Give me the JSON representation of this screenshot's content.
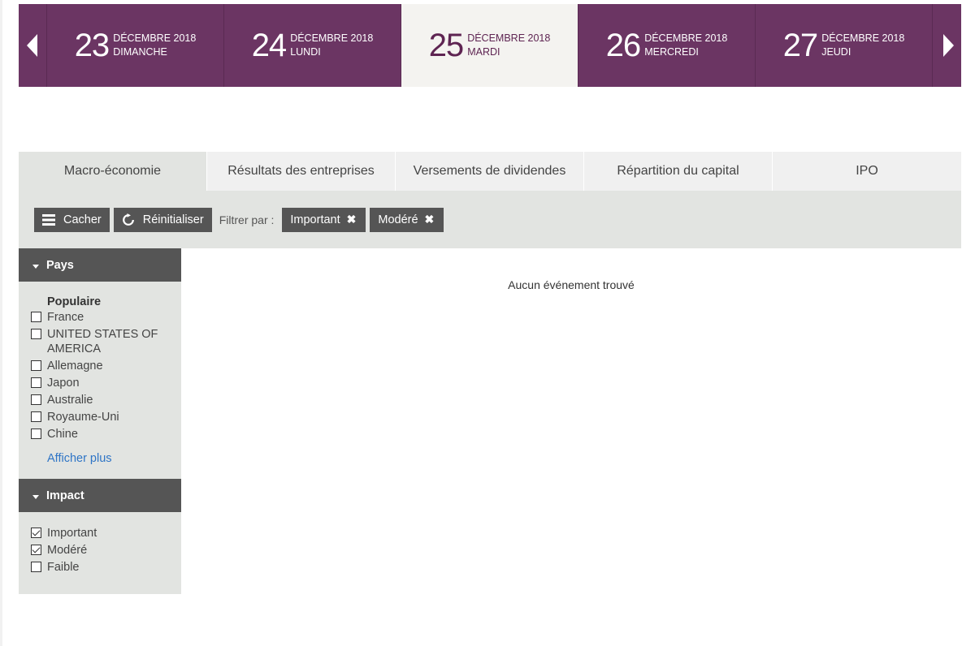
{
  "dates": {
    "prev_icon": "chevron-left-icon",
    "next_icon": "chevron-right-icon",
    "days": [
      {
        "num": "23",
        "month": "DÉCEMBRE 2018",
        "weekday": "DIMANCHE",
        "active": false
      },
      {
        "num": "24",
        "month": "DÉCEMBRE 2018",
        "weekday": "LUNDI",
        "active": false
      },
      {
        "num": "25",
        "month": "DÉCEMBRE 2018",
        "weekday": "MARDI",
        "active": true
      },
      {
        "num": "26",
        "month": "DÉCEMBRE 2018",
        "weekday": "MERCREDI",
        "active": false
      },
      {
        "num": "27",
        "month": "DÉCEMBRE 2018",
        "weekday": "JEUDI",
        "active": false
      }
    ]
  },
  "tabs": [
    {
      "label": "Macro-économie",
      "active": true
    },
    {
      "label": "Résultats des entreprises",
      "active": false
    },
    {
      "label": "Versements de dividendes",
      "active": false
    },
    {
      "label": "Répartition du capital",
      "active": false
    },
    {
      "label": "IPO",
      "active": false
    }
  ],
  "filterbar": {
    "hide_label": "Cacher",
    "reset_label": "Réinitialiser",
    "filter_by_label": "Filtrer par :",
    "chips": [
      "Important",
      "Modéré"
    ]
  },
  "sidebar": {
    "country": {
      "title": "Pays",
      "group_title": "Populaire",
      "items": [
        {
          "label": "France",
          "checked": false
        },
        {
          "label": "UNITED STATES OF AMERICA",
          "checked": false
        },
        {
          "label": "Allemagne",
          "checked": false
        },
        {
          "label": "Japon",
          "checked": false
        },
        {
          "label": "Australie",
          "checked": false
        },
        {
          "label": "Royaume-Uni",
          "checked": false
        },
        {
          "label": "Chine",
          "checked": false
        }
      ],
      "more_label": "Afficher plus"
    },
    "impact": {
      "title": "Impact",
      "items": [
        {
          "label": "Important",
          "checked": true
        },
        {
          "label": "Modéré",
          "checked": true
        },
        {
          "label": "Faible",
          "checked": false
        }
      ]
    }
  },
  "main": {
    "empty_message": "Aucun événement trouvé"
  },
  "colors": {
    "brand_purple": "#6b3563",
    "active_day_bg": "#f4f3f0",
    "panel_gray": "#e2e4e1",
    "dark_button": "#555555",
    "link_blue": "#2f75c6"
  }
}
